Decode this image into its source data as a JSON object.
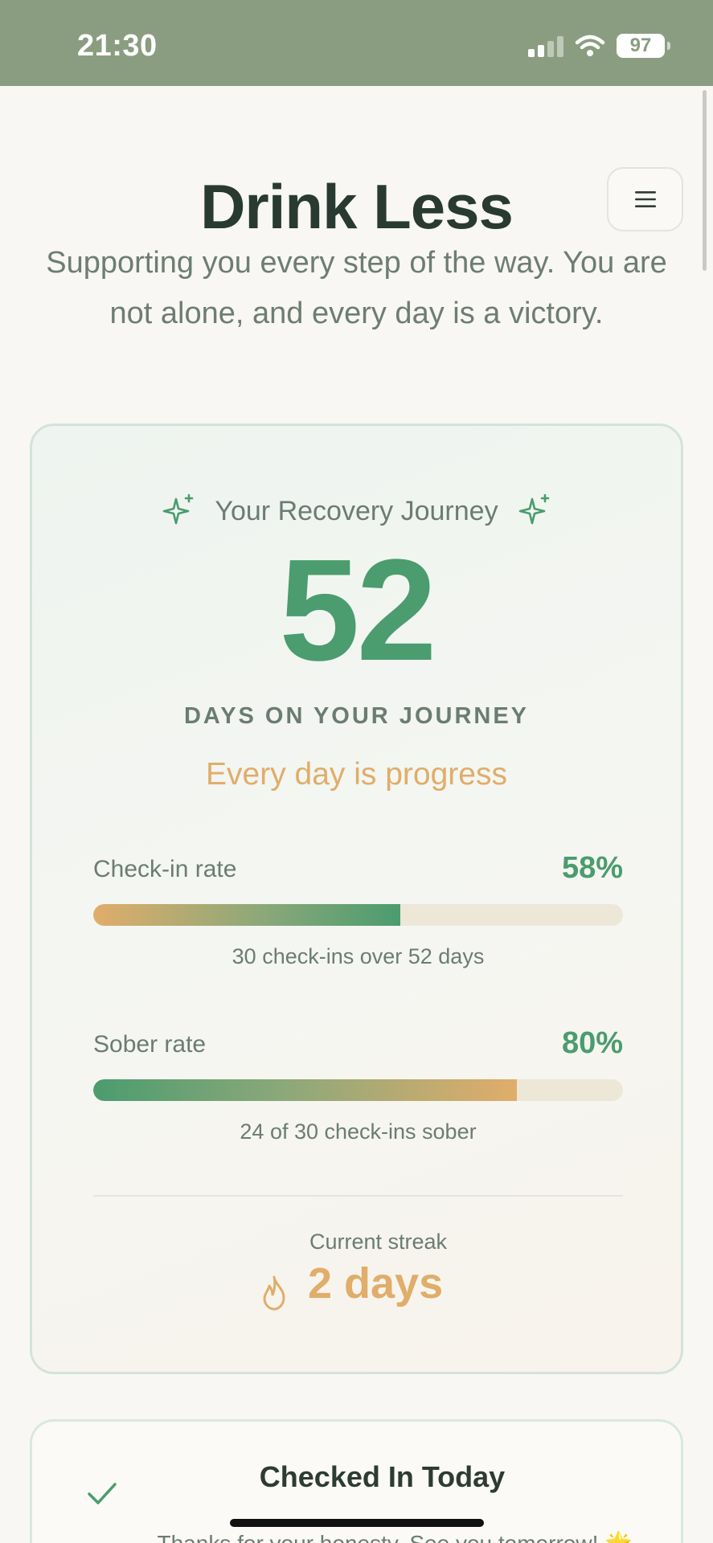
{
  "status": {
    "time": "21:30",
    "battery": "97"
  },
  "header": {
    "title": "Drink Less",
    "subtitle": "Supporting you every step of the way. You are not alone, and every day is a victory."
  },
  "journey": {
    "heading": "Your Recovery Journey",
    "days": "52",
    "days_label": "DAYS ON YOUR JOURNEY",
    "encouragement": "Every day is progress"
  },
  "stats": {
    "checkin": {
      "label": "Check-in rate",
      "value": "58%",
      "fraction": 0.58,
      "caption": "30 check-ins over 52 days"
    },
    "sober": {
      "label": "Sober rate",
      "value": "80%",
      "fraction": 0.8,
      "caption": "24 of 30 check-ins sober"
    }
  },
  "streak": {
    "label": "Current streak",
    "value": "2 days"
  },
  "checked_in": {
    "title": "Checked In Today",
    "message": "Thanks for your honesty. See you tomorrow! 🌟"
  },
  "colors": {
    "accent_green": "#4b9c6e",
    "accent_gold": "#e0ad6a",
    "status_bar": "#8a9d80"
  },
  "icons": {
    "menu": "hamburger-menu-icon",
    "journey_left": "sparkle-icon",
    "journey_right": "sparkle-icon",
    "streak": "flame-icon",
    "checked_in": "checkmark-icon"
  }
}
